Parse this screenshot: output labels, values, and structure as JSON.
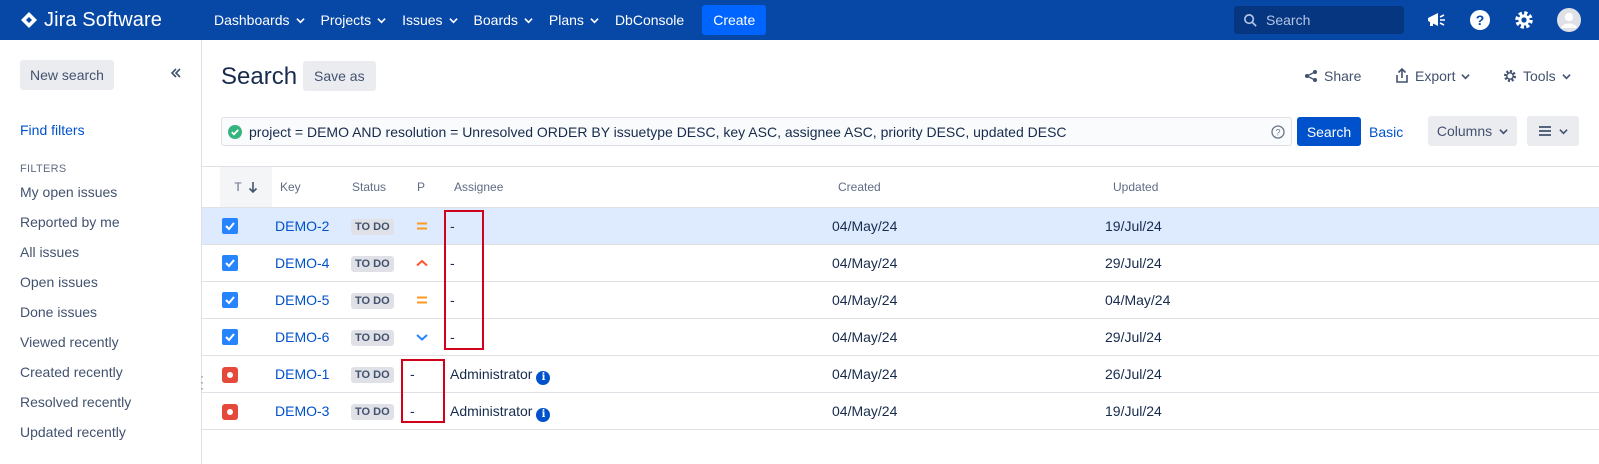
{
  "nav": {
    "brand": "Jira Software",
    "items": [
      "Dashboards",
      "Projects",
      "Issues",
      "Boards",
      "Plans",
      "DbConsole"
    ],
    "create": "Create",
    "search_placeholder": "Search"
  },
  "sidebar": {
    "new_search": "New search",
    "find_filters": "Find filters",
    "filters_heading": "FILTERS",
    "filters": [
      "My open issues",
      "Reported by me",
      "All issues",
      "Open issues",
      "Done issues",
      "Viewed recently",
      "Created recently",
      "Resolved recently",
      "Updated recently"
    ]
  },
  "main": {
    "title": "Search",
    "save_as": "Save as",
    "share": "Share",
    "export": "Export",
    "tools": "Tools",
    "jql": "project = DEMO AND resolution = Unresolved ORDER BY issuetype DESC, key ASC, assignee ASC, priority DESC, updated DESC",
    "search_button": "Search",
    "basic": "Basic",
    "columns": "Columns"
  },
  "table": {
    "headers": {
      "type": "T",
      "key": "Key",
      "status": "Status",
      "priority": "P",
      "assignee": "Assignee",
      "created": "Created",
      "updated": "Updated"
    },
    "rows": [
      {
        "type": "task",
        "key": "DEMO-2",
        "status": "TO DO",
        "priority": "medium",
        "priority_mark": "",
        "assignee": "-",
        "created": "04/May/24",
        "updated": "19/Jul/24",
        "selected": true
      },
      {
        "type": "task",
        "key": "DEMO-4",
        "status": "TO DO",
        "priority": "high",
        "priority_mark": "",
        "assignee": "-",
        "created": "04/May/24",
        "updated": "29/Jul/24",
        "selected": false
      },
      {
        "type": "task",
        "key": "DEMO-5",
        "status": "TO DO",
        "priority": "medium",
        "priority_mark": "",
        "assignee": "-",
        "created": "04/May/24",
        "updated": "04/May/24",
        "selected": false
      },
      {
        "type": "task",
        "key": "DEMO-6",
        "status": "TO DO",
        "priority": "low",
        "priority_mark": "",
        "assignee": "-",
        "created": "04/May/24",
        "updated": "29/Jul/24",
        "selected": false
      },
      {
        "type": "bug",
        "key": "DEMO-1",
        "status": "TO DO",
        "priority": "none",
        "priority_mark": "-",
        "assignee": "Administrator",
        "created": "04/May/24",
        "updated": "26/Jul/24",
        "selected": false
      },
      {
        "type": "bug",
        "key": "DEMO-3",
        "status": "TO DO",
        "priority": "none",
        "priority_mark": "-",
        "assignee": "Administrator",
        "created": "04/May/24",
        "updated": "19/Jul/24",
        "selected": false
      }
    ]
  },
  "colors": {
    "nav": "#0747a6",
    "link": "#0052cc",
    "highlight": "#d0021b",
    "selected_row": "#deebff"
  }
}
